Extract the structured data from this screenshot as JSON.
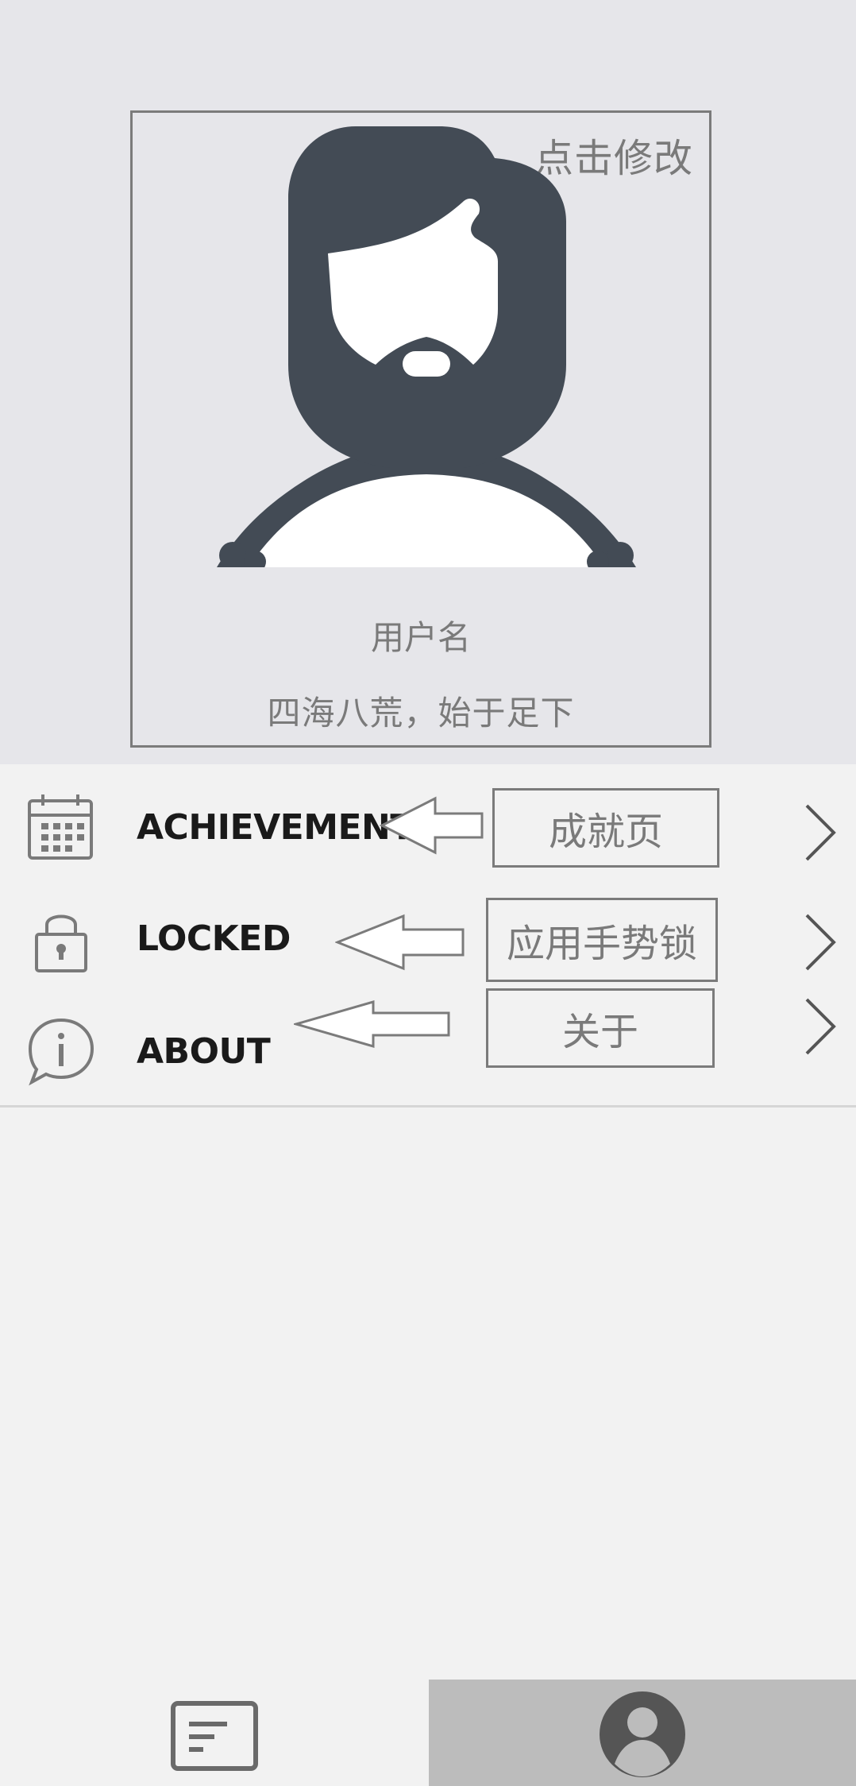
{
  "profile": {
    "edit_label": "点击修改",
    "username": "用户名",
    "motto": "四海八荒，始于足下"
  },
  "menu": {
    "items": [
      {
        "label": "ACHIEVEMENT",
        "note": "成就页",
        "icon": "calendar-icon"
      },
      {
        "label": "LOCKED",
        "note": "应用手势锁",
        "icon": "lock-icon"
      },
      {
        "label": "ABOUT",
        "note": "关于",
        "icon": "info-chat-icon"
      }
    ]
  },
  "bottom_nav": {
    "tabs": [
      {
        "icon": "article-list-icon",
        "active": false
      },
      {
        "icon": "user-profile-icon",
        "active": true
      }
    ]
  },
  "colors": {
    "avatar": "#434b55",
    "header_bg": "#e6e6ea",
    "body_bg": "#f2f2f2",
    "active_tab_bg": "#bcbcbc"
  }
}
